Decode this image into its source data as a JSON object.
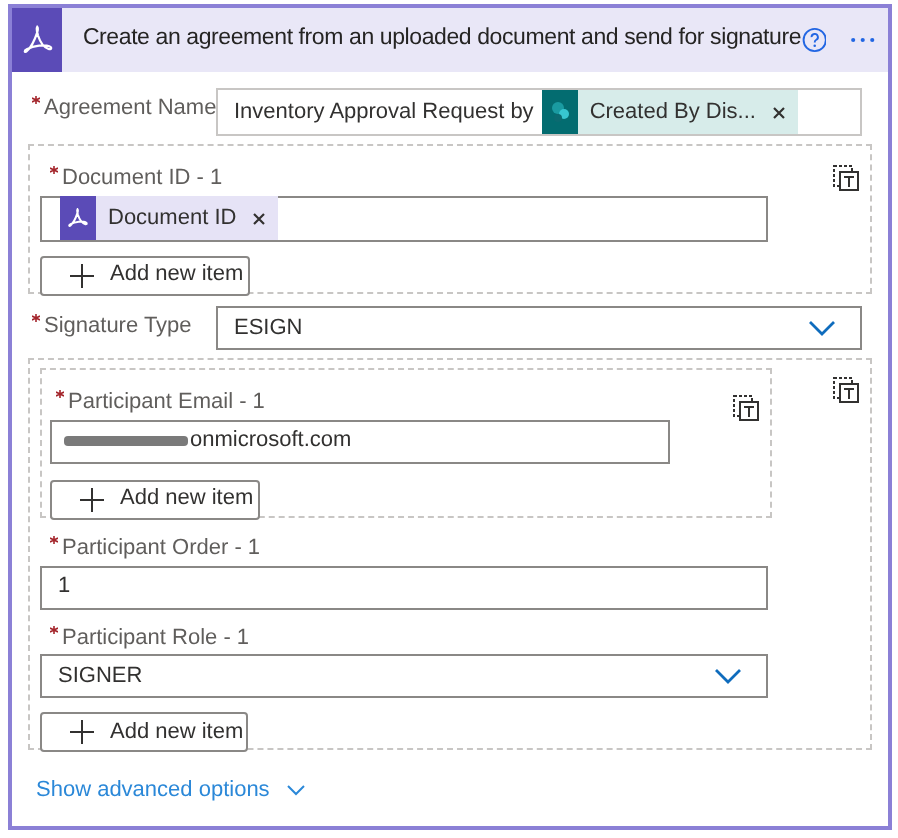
{
  "header": {
    "title": "Create an agreement from an uploaded document and send for signature"
  },
  "agreement_name": {
    "label": "Agreement Name",
    "required": true,
    "text": "Inventory Approval Request by",
    "token": {
      "label": "Created By Dis...",
      "kind": "sharepoint"
    }
  },
  "document_id": {
    "label": "Document ID - 1",
    "required": true,
    "token": {
      "label": "Document ID",
      "kind": "adobe"
    },
    "add_button": "Add new item"
  },
  "signature_type": {
    "label": "Signature Type",
    "required": true,
    "value": "ESIGN"
  },
  "participants": {
    "email": {
      "label": "Participant Email - 1",
      "required": true,
      "value": "onmicrosoft.com",
      "add_button": "Add new item"
    },
    "order": {
      "label": "Participant Order - 1",
      "required": true,
      "value": "1"
    },
    "role": {
      "label": "Participant Role - 1",
      "required": true,
      "value": "SIGNER"
    },
    "add_button": "Add new item"
  },
  "advanced_link": "Show advanced options"
}
